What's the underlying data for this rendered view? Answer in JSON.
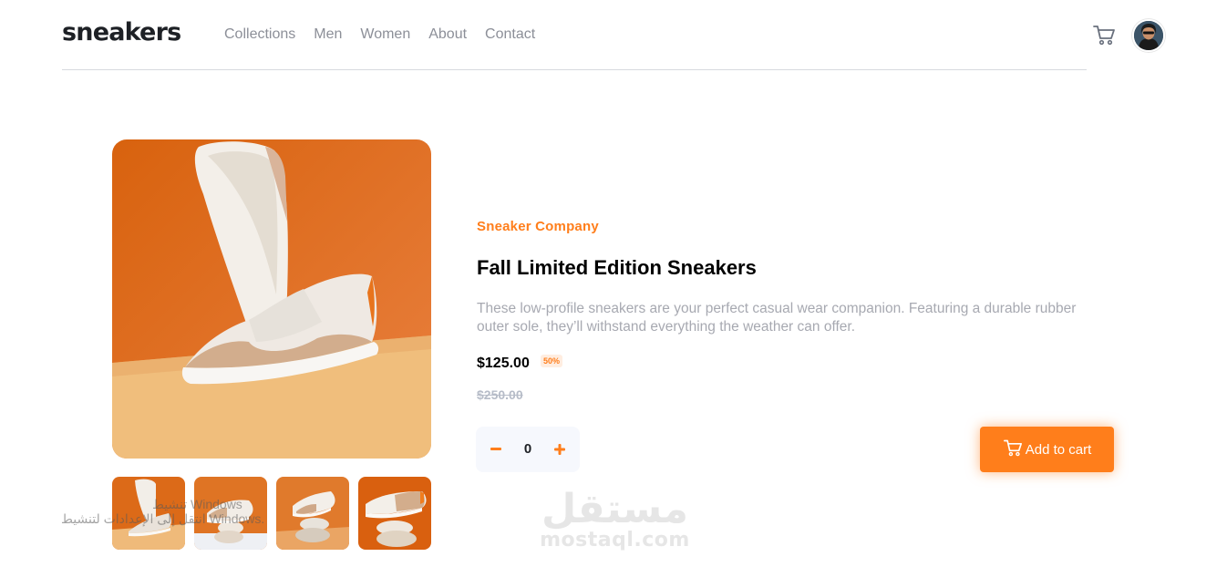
{
  "header": {
    "logo": "sneakers",
    "nav": [
      "Collections",
      "Men",
      "Women",
      "About",
      "Contact"
    ],
    "cart_icon": "cart-icon",
    "avatar_icon": "avatar"
  },
  "gallery": {
    "main_alt": "sneaker-main-image",
    "thumbnails": [
      "thumbnail-1",
      "thumbnail-2",
      "thumbnail-3",
      "thumbnail-4"
    ]
  },
  "product": {
    "company": "Sneaker Company",
    "title": "Fall Limited Edition Sneakers",
    "description": "These low-profile sneakers are your perfect casual wear companion. Featuring a durable rubber outer sole, they’ll withstand everything the weather can offer.",
    "price": "$125.00",
    "discount": "50%",
    "old_price": "$250.00"
  },
  "cart": {
    "quantity": "0",
    "minus_icon": "minus-icon",
    "plus_icon": "plus-icon",
    "add_label": "Add to cart"
  },
  "watermark": {
    "arabic": "مستقل",
    "latin": "mostaql.com"
  },
  "activation": {
    "line1": "تنشيط Windows",
    "line2": "انتقل إلى الإعدادات لتنشيط Windows."
  },
  "colors": {
    "accent": "#ff7e1b",
    "accent_light": "#ffede0",
    "text_dark": "#1d2025",
    "text_muted": "#a7a9b1"
  }
}
